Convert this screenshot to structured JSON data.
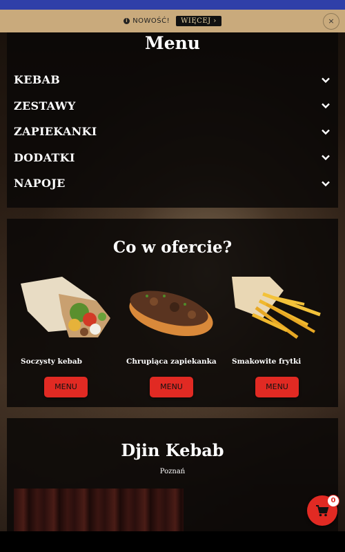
{
  "notice": {
    "text": "NOWOŚĆ!",
    "more_label": "WIĘCEJ ›",
    "close_label": "×"
  },
  "menu": {
    "title": "Menu",
    "categories": [
      {
        "label": "KEBAB"
      },
      {
        "label": "ZESTAWY"
      },
      {
        "label": "ZAPIEKANKI"
      },
      {
        "label": "DODATKI"
      },
      {
        "label": "NAPOJE"
      }
    ]
  },
  "offer": {
    "title": "Co w ofercie?",
    "items": [
      {
        "name": "Soczysty kebab",
        "button_label": "MENU"
      },
      {
        "name": "Chrupiąca zapiekanka",
        "button_label": "MENU"
      },
      {
        "name": "Smakowite frytki",
        "button_label": "MENU"
      }
    ]
  },
  "restaurant": {
    "name": "Djin Kebab",
    "city": "Poznań"
  },
  "cart": {
    "count": "0"
  },
  "colors": {
    "accent": "#e12a23",
    "notice_bg": "#c9aa7c",
    "top_stripe": "#2f3fa8"
  }
}
